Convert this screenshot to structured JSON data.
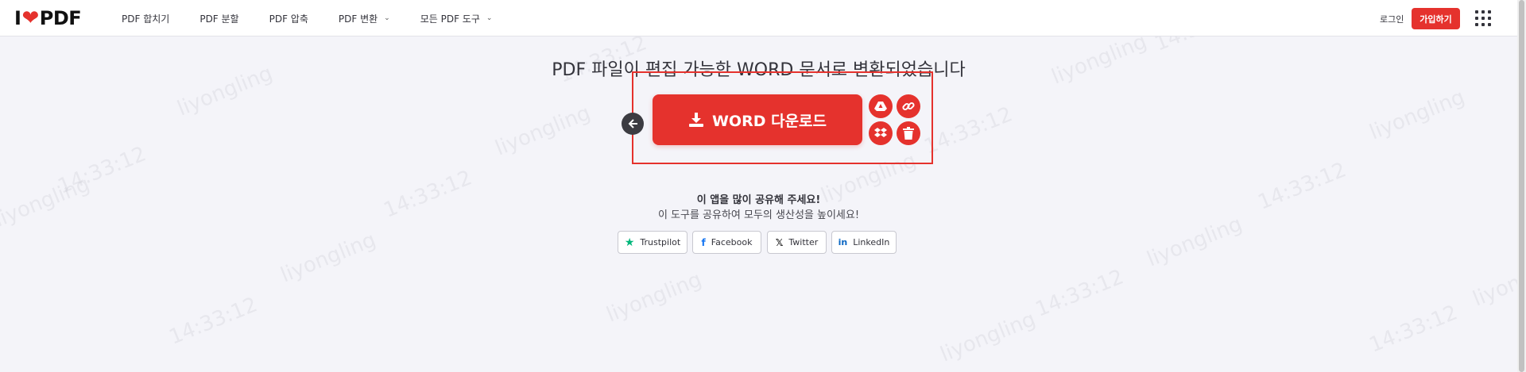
{
  "header": {
    "logo_left": "I",
    "logo_right": "PDF",
    "nav": [
      {
        "label": "PDF 합치기"
      },
      {
        "label": "PDF 분할"
      },
      {
        "label": "PDF 압축"
      },
      {
        "label": "PDF 변환"
      },
      {
        "label": "모든 PDF 도구"
      }
    ],
    "login_label": "로그인",
    "signup_label": "가입하기"
  },
  "main": {
    "title": "PDF 파일이 편집 가능한 WORD 문서로 변환되었습니다",
    "download_label": "WORD 다운로드"
  },
  "share": {
    "title": "이 앱을 많이 공유해 주세요!",
    "subtitle": "이 도구를 공유하여 모두의 생산성을 높이세요!",
    "buttons": [
      {
        "label": "Trustpilot"
      },
      {
        "label": "Facebook"
      },
      {
        "label": "Twitter"
      },
      {
        "label": "LinkedIn"
      }
    ]
  },
  "watermark": {
    "text": "liyongling",
    "time": "14:33:12"
  },
  "colors": {
    "accent": "#e5322d",
    "trustpilot": "#00b67a",
    "facebook": "#1877f2",
    "linkedin": "#0a66c2"
  }
}
